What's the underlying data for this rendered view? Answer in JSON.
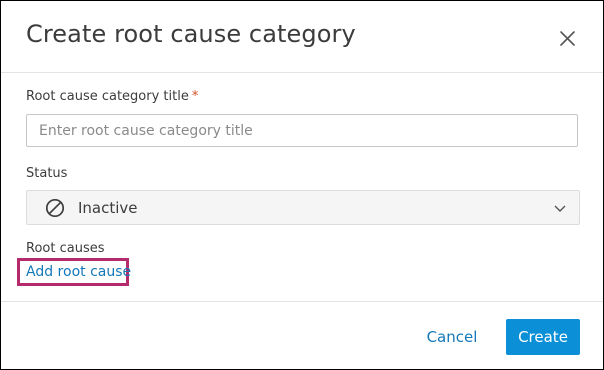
{
  "dialog": {
    "title": "Create root cause category",
    "close_icon": "close-icon"
  },
  "form": {
    "title_field": {
      "label": "Root cause category title",
      "required_marker": "*",
      "value": "",
      "placeholder": "Enter root cause category title"
    },
    "status_field": {
      "label": "Status",
      "selected_value": "Inactive",
      "selected_icon": "inactive-circle-slash-icon",
      "dropdown_icon": "chevron-down-icon"
    },
    "root_causes": {
      "label": "Root causes",
      "add_link": "Add root cause"
    }
  },
  "footer": {
    "cancel_label": "Cancel",
    "create_label": "Create"
  },
  "colors": {
    "primary": "#0b8fd6",
    "link": "#1478b8",
    "required": "#d74e26",
    "highlight_border": "#b5296d"
  }
}
